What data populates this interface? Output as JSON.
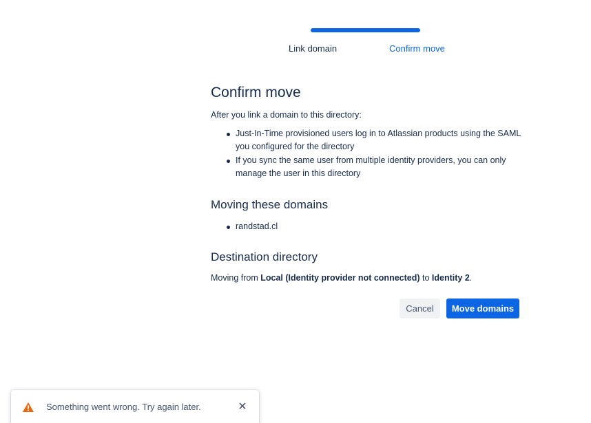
{
  "progress": {
    "active_fraction": 0.5,
    "steps": [
      {
        "label": "Link domain",
        "state": "done"
      },
      {
        "label": "Confirm move",
        "state": "current"
      }
    ]
  },
  "main": {
    "title": "Confirm move",
    "intro": "After you link a domain to this directory:",
    "rules": [
      "Just-In-Time provisioned users log in to Atlassian products using the SAML you configured for the directory",
      "If you sync the same user from multiple identity providers, you can only manage the user in this directory"
    ],
    "domains_heading": "Moving these domains",
    "domains": [
      "randstad.cl"
    ],
    "destination_heading": "Destination directory",
    "destination": {
      "prefix": "Moving from ",
      "from": "Local (Identity provider not connected)",
      "middle": " to ",
      "to": "Identity 2",
      "suffix": "."
    }
  },
  "actions": {
    "cancel_label": "Cancel",
    "move_label": "Move domains"
  },
  "flag": {
    "icon": "warning-icon",
    "message": "Something went wrong. Try again later.",
    "close_icon": "close-icon"
  },
  "colors": {
    "accent": "#0c66e4",
    "text": "#172b4d",
    "warning": "#e56910"
  }
}
